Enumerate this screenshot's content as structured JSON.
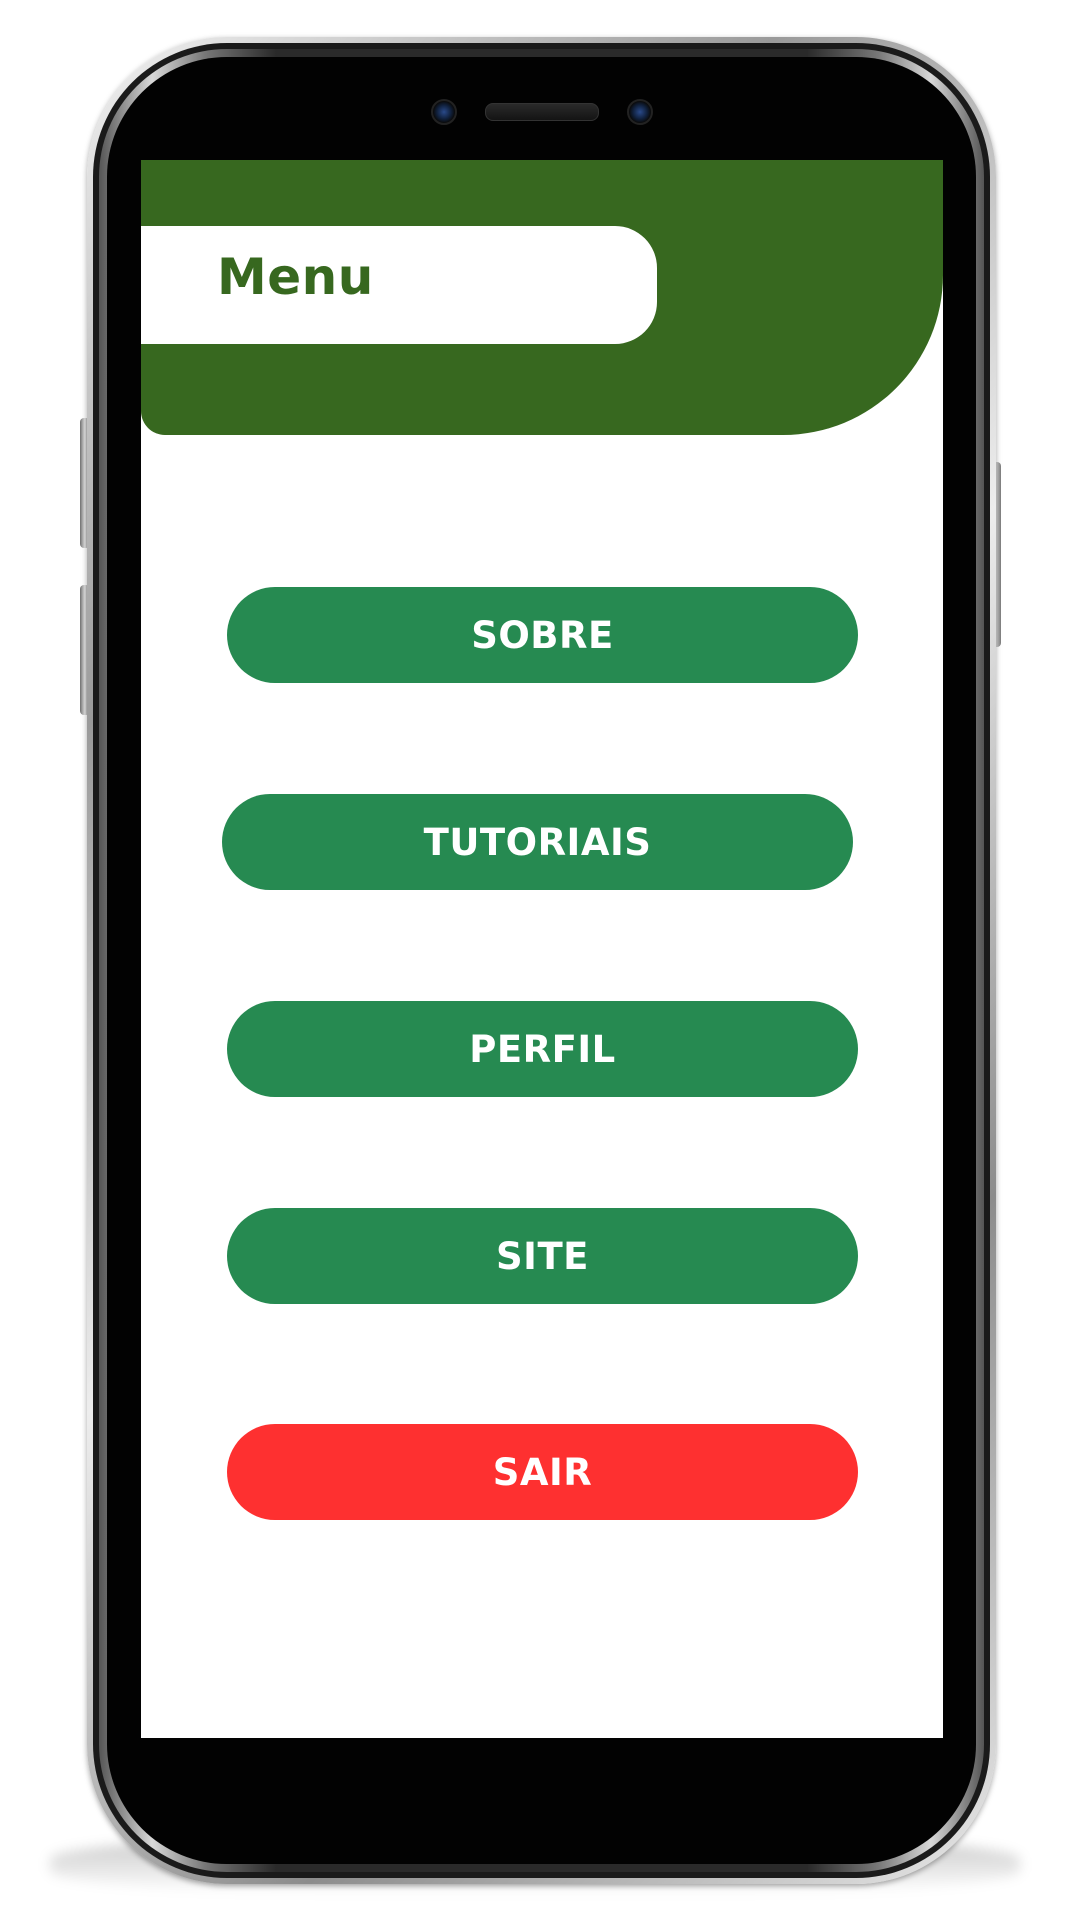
{
  "header": {
    "title": "Menu"
  },
  "menu": {
    "items": [
      {
        "label": "SOBRE"
      },
      {
        "label": "TUTORIAIS"
      },
      {
        "label": "PERFIL"
      },
      {
        "label": "SITE"
      }
    ],
    "exit_label": "SAIR"
  },
  "colors": {
    "header_green": "#37681f",
    "button_green": "#268a51",
    "exit_red": "#fe3030",
    "background": "#ffffff"
  }
}
